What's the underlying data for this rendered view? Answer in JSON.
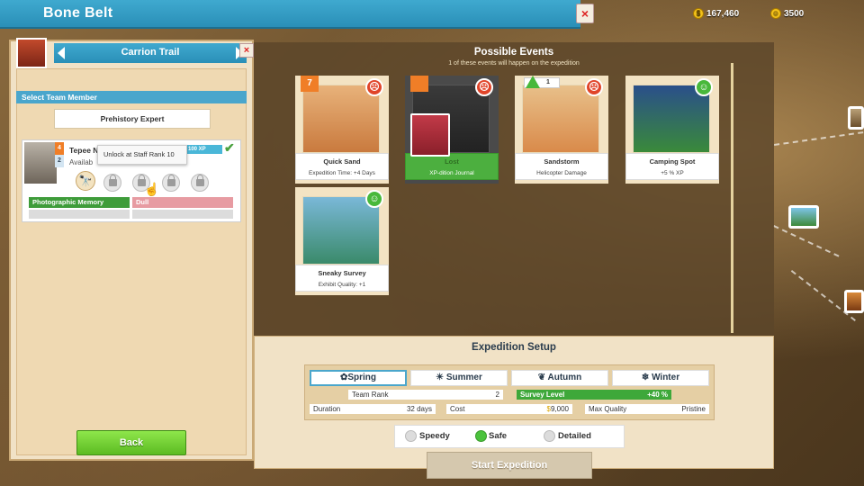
{
  "header": {
    "title": "Bone Belt",
    "close_label": "×"
  },
  "currencies": [
    {
      "icon": "coin-icon",
      "value": "167,460"
    },
    {
      "icon": "kudos-icon",
      "value": "3500"
    }
  ],
  "left_panel": {
    "trail_name": "Carrion Trail",
    "select_header": "Select Team Member",
    "role": "Prehistory Expert",
    "member": {
      "name": "Tepee N",
      "status": "Availab",
      "rank": "2",
      "level_badge": "4",
      "xp_label": "100 XP",
      "tooltip": "Unlock at Staff Rank 10",
      "traits": {
        "good": "Photographic Memory",
        "bad": "Dull"
      }
    },
    "back_label": "Back"
  },
  "events": {
    "title": "Possible Events",
    "subtitle": "1 of these events will happen on the expedition",
    "cards": [
      {
        "name": "Quick Sand",
        "desc": "Expedition Time: +4 Days",
        "badge": "7",
        "outcome": "bad"
      },
      {
        "name": "Lost",
        "desc": "XP-dition Journal",
        "outcome": "bad",
        "highlight": true
      },
      {
        "name": "Sandstorm",
        "desc": "Helicopter Damage",
        "badge": "1",
        "outcome": "bad"
      },
      {
        "name": "Camping Spot",
        "desc": "+5 % XP",
        "outcome": "good"
      },
      {
        "name": "Sneaky Survey",
        "desc": "Exhibit Quality: +1",
        "outcome": "good"
      }
    ]
  },
  "setup": {
    "title": "Expedition Setup",
    "seasons": [
      "Spring",
      "Summer",
      "Autumn",
      "Winter"
    ],
    "selected_season": "Spring",
    "stats": {
      "team_rank": {
        "label": "Team Rank",
        "value": "2"
      },
      "survey_level": {
        "label": "Survey Level",
        "value": "+40 %"
      },
      "duration": {
        "label": "Duration",
        "value": "32 days"
      },
      "cost": {
        "label": "Cost",
        "value": "9,000"
      },
      "max_quality": {
        "label": "Max Quality",
        "value": "Pristine"
      }
    },
    "modes": [
      "Speedy",
      "Safe",
      "Detailed"
    ],
    "selected_mode": "Safe",
    "start_label": "Start Expedition"
  },
  "colors": {
    "accent_blue": "#3fa9cf",
    "green": "#5cbb22",
    "bad_red": "#e0452a",
    "good_green": "#48b83b"
  }
}
